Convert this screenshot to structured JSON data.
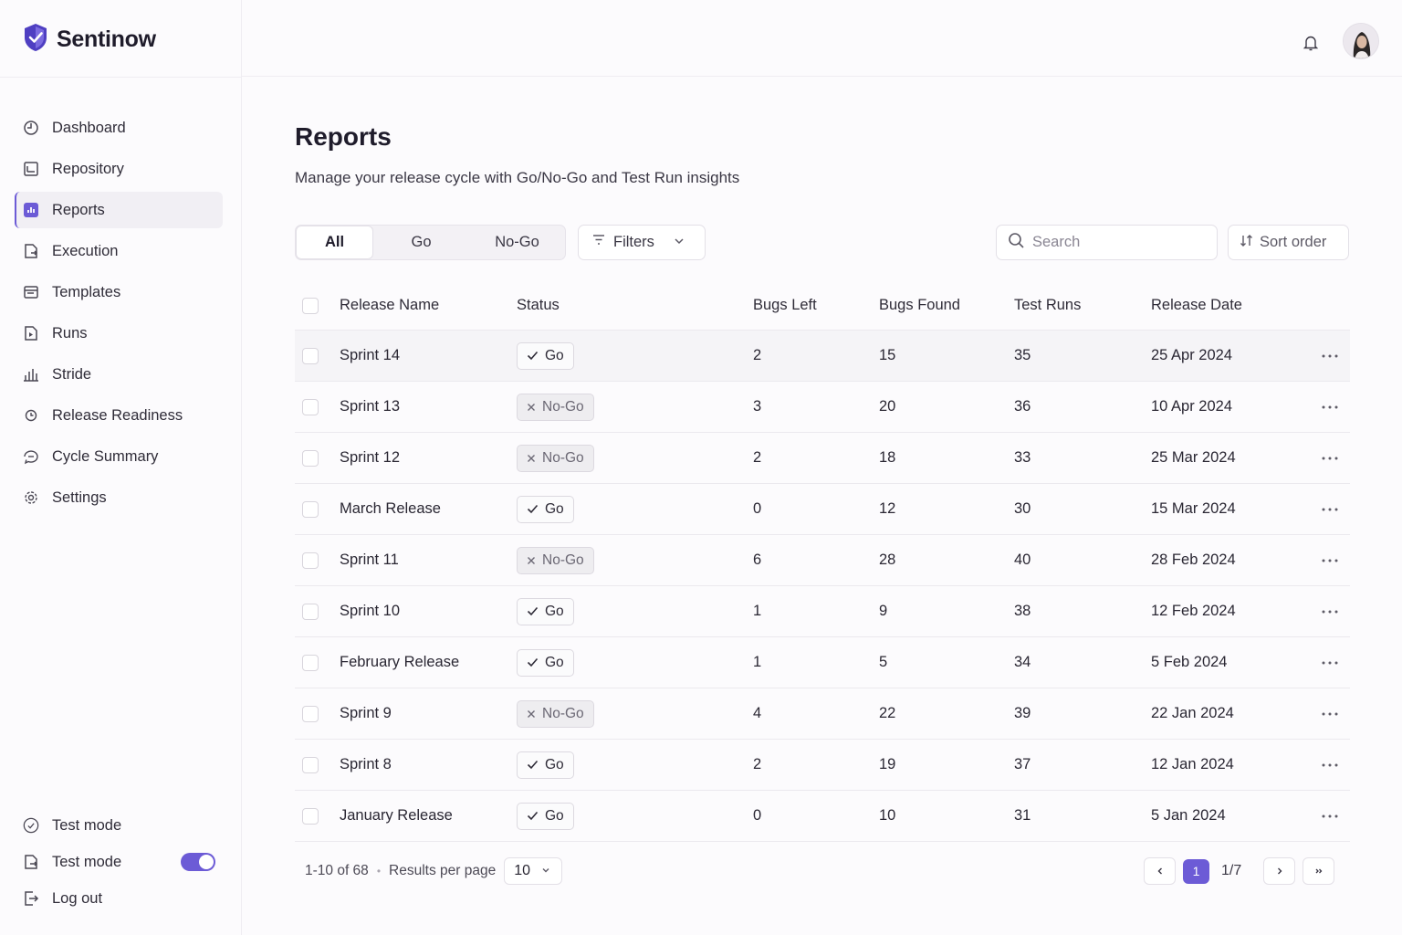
{
  "app": {
    "name": "Sentinow",
    "brand_color": "#6c5bd6"
  },
  "sidebar": {
    "items": [
      {
        "label": "Dashboard",
        "icon": "dashboard-icon"
      },
      {
        "label": "Repository",
        "icon": "repository-icon"
      },
      {
        "label": "Reports",
        "icon": "reports-icon",
        "active": true
      },
      {
        "label": "Execution",
        "icon": "execution-icon"
      },
      {
        "label": "Templates",
        "icon": "templates-icon"
      },
      {
        "label": "Runs",
        "icon": "runs-icon"
      },
      {
        "label": "Stride",
        "icon": "bar-chart-icon"
      },
      {
        "label": "Release Readiness",
        "icon": "clock-icon"
      },
      {
        "label": "Cycle Summary",
        "icon": "cycle-summary-icon"
      },
      {
        "label": "Settings",
        "icon": "gear-icon"
      }
    ],
    "bottom": {
      "test_mode_1": "Test mode",
      "test_mode_2": "Test mode",
      "test_mode_toggle_on": true,
      "logout": "Log out"
    }
  },
  "header": {
    "bell_icon": "bell-icon",
    "avatar": "user-avatar"
  },
  "page": {
    "title": "Reports",
    "subtitle": "Manage your release cycle with Go/No-Go and Test Run insights"
  },
  "toolbar": {
    "segments": [
      "All",
      "Go",
      "No-Go"
    ],
    "active_segment": "All",
    "filters_label": "Filters",
    "search_placeholder": "Search",
    "sort_label": "Sort order"
  },
  "table": {
    "columns": [
      "Release Name",
      "Status",
      "Bugs Left",
      "Bugs Found",
      "Test Runs",
      "Release Date"
    ],
    "rows": [
      {
        "name": "Sprint 14",
        "status": "Go",
        "bugs_left": "2",
        "bugs_found": "15",
        "test_runs": "35",
        "date": "25 Apr 2024"
      },
      {
        "name": "Sprint 13",
        "status": "No-Go",
        "bugs_left": "3",
        "bugs_found": "20",
        "test_runs": "36",
        "date": "10 Apr 2024"
      },
      {
        "name": "Sprint 12",
        "status": "No-Go",
        "bugs_left": "2",
        "bugs_found": "18",
        "test_runs": "33",
        "date": "25 Mar 2024"
      },
      {
        "name": "March Release",
        "status": "Go",
        "bugs_left": "0",
        "bugs_found": "12",
        "test_runs": "30",
        "date": "15 Mar 2024"
      },
      {
        "name": "Sprint 11",
        "status": "No-Go",
        "bugs_left": "6",
        "bugs_found": "28",
        "test_runs": "40",
        "date": "28 Feb 2024"
      },
      {
        "name": "Sprint 10",
        "status": "Go",
        "bugs_left": "1",
        "bugs_found": "9",
        "test_runs": "38",
        "date": "12 Feb 2024"
      },
      {
        "name": "February Release",
        "status": "Go",
        "bugs_left": "1",
        "bugs_found": "5",
        "test_runs": "34",
        "date": "5 Feb 2024"
      },
      {
        "name": "Sprint 9",
        "status": "No-Go",
        "bugs_left": "4",
        "bugs_found": "22",
        "test_runs": "39",
        "date": "22 Jan 2024"
      },
      {
        "name": "Sprint 8",
        "status": "Go",
        "bugs_left": "2",
        "bugs_found": "19",
        "test_runs": "37",
        "date": "12 Jan 2024"
      },
      {
        "name": "January Release",
        "status": "Go",
        "bugs_left": "0",
        "bugs_found": "10",
        "test_runs": "31",
        "date": "5 Jan 2024"
      }
    ]
  },
  "pagination": {
    "range": "1-10 of 68",
    "per_page_label": "Results per page",
    "per_page_value": "10",
    "current_page": "1",
    "page_count": "1/7"
  }
}
